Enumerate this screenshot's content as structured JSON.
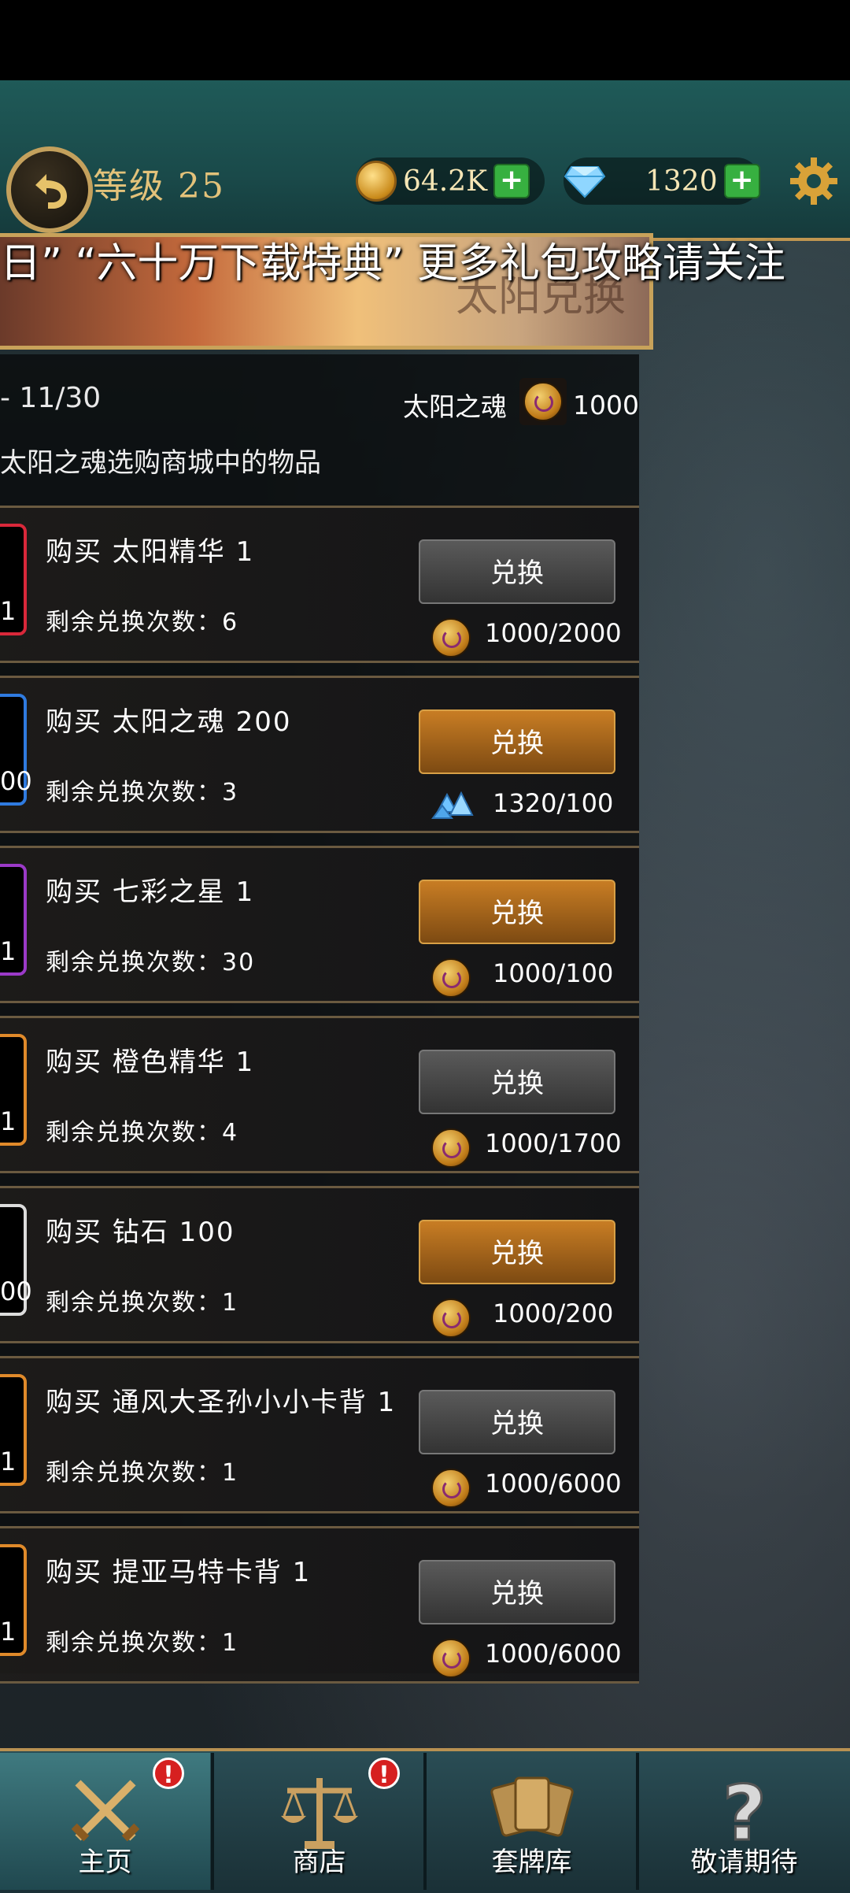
{
  "header": {
    "level_label": "等级 25",
    "coins": "64.2K",
    "gems": "1320"
  },
  "banner": {
    "title": "太阳兑换",
    "marquee": "日”  “六十万下载特典”  更多礼包攻略请关注"
  },
  "event": {
    "date_range": "- 11/30",
    "soul_label": "太阳之魂",
    "soul_amount": "1000",
    "description": "太阳之魂选购商城中的物品"
  },
  "items": [
    {
      "title": "购买 太阳精华 1",
      "remain": "剩余兑换次数：6",
      "qty": "1",
      "button": "兑换",
      "cost": "1000/2000",
      "cost_icon": "sun-soul-icon",
      "enabled": false,
      "border": "#d9283a"
    },
    {
      "title": "购买 太阳之魂 200",
      "remain": "剩余兑换次数：3",
      "qty": "00",
      "button": "兑换",
      "cost": "1320/100",
      "cost_icon": "crystal-icon",
      "enabled": true,
      "border": "#2f7be0"
    },
    {
      "title": "购买 七彩之星  1",
      "remain": "剩余兑换次数：30",
      "qty": "1",
      "button": "兑换",
      "cost": "1000/100",
      "cost_icon": "sun-soul-icon",
      "enabled": true,
      "border": "#9b3ac8"
    },
    {
      "title": "购买 橙色精华  1",
      "remain": "剩余兑换次数：4",
      "qty": "1",
      "button": "兑换",
      "cost": "1000/1700",
      "cost_icon": "sun-soul-icon",
      "enabled": false,
      "border": "#e08a2a"
    },
    {
      "title": "购买 钻石  100",
      "remain": "剩余兑换次数：1",
      "qty": "00",
      "button": "兑换",
      "cost": "1000/200",
      "cost_icon": "sun-soul-icon",
      "enabled": true,
      "border": "#dcdcdc"
    },
    {
      "title": "购买 通风大圣孙小小卡背 1",
      "remain": "剩余兑换次数：1",
      "qty": "1",
      "button": "兑换",
      "cost": "1000/6000",
      "cost_icon": "sun-soul-icon",
      "enabled": false,
      "border": "#e08a2a"
    },
    {
      "title": "购买 提亚马特卡背 1",
      "remain": "剩余兑换次数：1",
      "qty": "1",
      "button": "兑换",
      "cost": "1000/6000",
      "cost_icon": "sun-soul-icon",
      "enabled": false,
      "border": "#e08a2a"
    }
  ],
  "nav": {
    "tabs": [
      {
        "label": "主页",
        "icon": "swords-icon",
        "badge": "!"
      },
      {
        "label": "商店",
        "icon": "scales-icon",
        "badge": "!"
      },
      {
        "label": "套牌库",
        "icon": "cards-icon"
      },
      {
        "label": "敬请期待",
        "icon": "question-icon"
      }
    ]
  },
  "colors": {
    "gold_button": "#c87d24",
    "gray_button": "#4a4a4a",
    "nav_bg": "#2a4d55",
    "top_bar": "#1f5a58"
  }
}
